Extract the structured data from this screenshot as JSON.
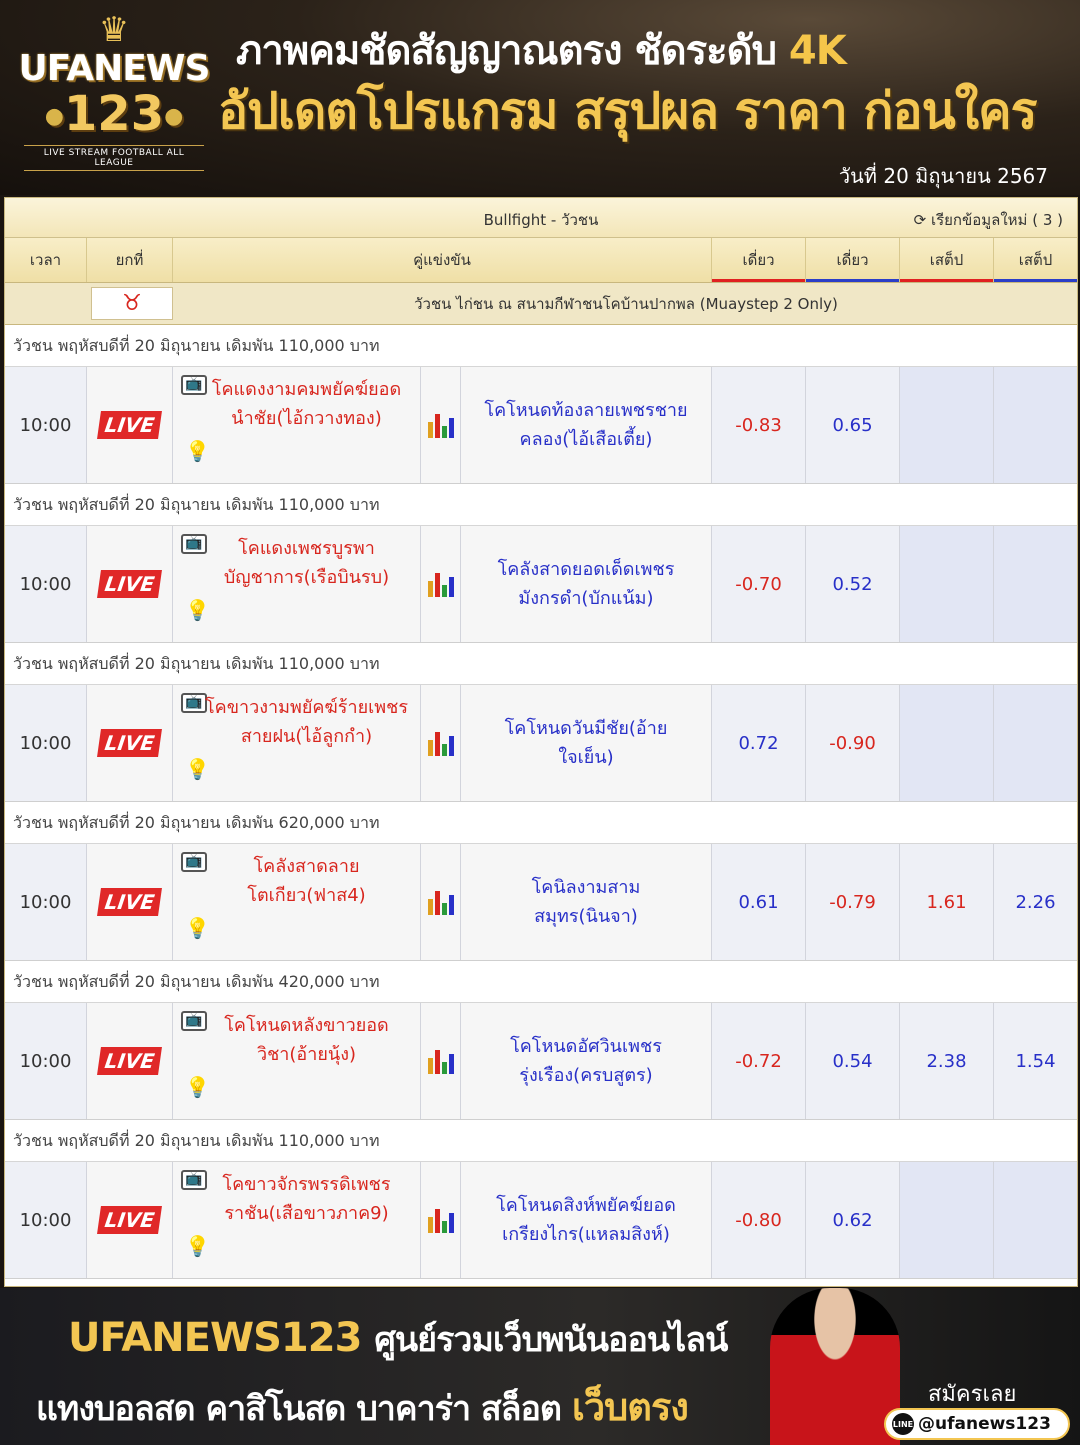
{
  "header": {
    "logo_brand": "UFANEWS",
    "logo_number": "123",
    "logo_tagline": "LIVE STREAM FOOTBALL ALL LEAGUE",
    "headline1_text": "ภาพคมชัดสัญญาณตรง ชัดระดับ",
    "headline1_highlight": "4K",
    "headline2": "อัปเดตโปรแกรม สรุปผล ราคา ก่อนใคร",
    "date": "วันที่ 20 มิถุนายน 2567"
  },
  "panel": {
    "title": "Bullfight - วัวชน",
    "refresh_label": "เรียกข้อมูลใหม่ ( 3 )",
    "columns": [
      "เวลา",
      "ยกที่",
      "คู่แข่งขัน",
      "เดี่ยว",
      "เดี่ยว",
      "เสต็ป",
      "เสต็ป"
    ],
    "league_name": "วัวชน ไก่ชน ณ สนามกีฬาชนโคบ้านปากพล (Muaystep 2 Only)",
    "live_label": "LIVE",
    "matches": [
      {
        "subheader": "วัวชน พฤหัสบดีที่ 20 มิถุนายน เดิมพัน 110,000 บาท",
        "time": "10:00",
        "home": "โคแดงงามคมพยัคฆ์ยอดนำชัย(ไอ้กวางทอง)",
        "away": "โคโหนดท้องลายเพชรชายคลอง(ไอ้เสือเตี้ย)",
        "odds": [
          "-0.83",
          "0.65",
          "",
          ""
        ]
      },
      {
        "subheader": "วัวชน พฤหัสบดีที่ 20 มิถุนายน เดิมพัน 110,000 บาท",
        "time": "10:00",
        "home": "โคแดงเพชรบูรพาบัญชาการ(เรือบินรบ)",
        "away": "โคลังสาดยอดเด็ดเพชรมังกรดำ(บักแน้ม)",
        "odds": [
          "-0.70",
          "0.52",
          "",
          ""
        ]
      },
      {
        "subheader": "วัวชน พฤหัสบดีที่ 20 มิถุนายน เดิมพัน 110,000 บาท",
        "time": "10:00",
        "home": "โคขาวงามพยัคฆ์ร้ายเพชรสายฝน(ไอ้ลูกกำ)",
        "away": "โคโหนดวันมีชัย(อ้ายใจเย็น)",
        "odds": [
          "0.72",
          "-0.90",
          "",
          ""
        ]
      },
      {
        "subheader": "วัวชน พฤหัสบดีที่ 20 มิถุนายน เดิมพัน 620,000 บาท",
        "time": "10:00",
        "home": "โคลังสาดลายโตเกียว(ฟาส4)",
        "away": "โคนิลงามสามสมุทร(นินจา)",
        "odds": [
          "0.61",
          "-0.79",
          "1.61",
          "2.26"
        ]
      },
      {
        "subheader": "วัวชน พฤหัสบดีที่ 20 มิถุนายน เดิมพัน 420,000 บาท",
        "time": "10:00",
        "home": "โคโหนดหลังขาวยอดวิชา(อ้ายนุ้ง)",
        "away": "โคโหนดอัศวินเพชรรุ่งเรือง(ครบสูตร)",
        "odds": [
          "-0.72",
          "0.54",
          "2.38",
          "1.54"
        ]
      },
      {
        "subheader": "วัวชน พฤหัสบดีที่ 20 มิถุนายน เดิมพัน 110,000 บาท",
        "time": "10:00",
        "home": "โคขาวจักรพรรดิเพชรราชัน(เสือขาวภาค9)",
        "away": "โคโหนดสิงห์พยัคฆ์ยอดเกรียงไกร(แหลมสิงห์)",
        "odds": [
          "-0.80",
          "0.62",
          "",
          ""
        ]
      }
    ]
  },
  "footer": {
    "brand": "UFANEWS123",
    "tagline": "ศูนย์รวมเว็บพนันออนไลน์",
    "services": "แทงบอลสด คาสิโนสด บาคาร่า สล็อต",
    "direct": "เว็บตรง",
    "apply": "สมัครเลย",
    "line_handle": "@ufanews123"
  },
  "colors": {
    "red": "#d8261e",
    "blue": "#2830c8",
    "gold": "#f3c652"
  }
}
